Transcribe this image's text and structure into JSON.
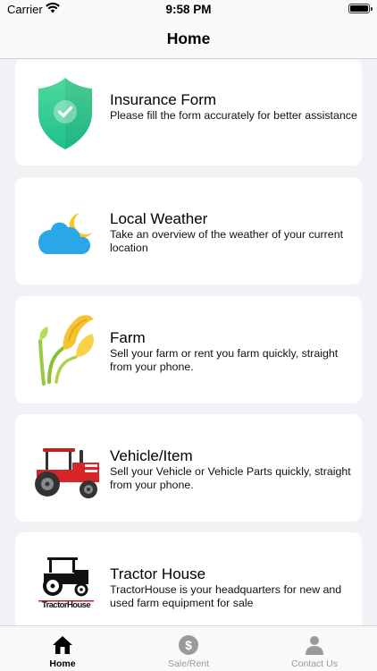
{
  "status_bar": {
    "carrier": "Carrier",
    "time": "9:58 PM",
    "battery_level": 1.0
  },
  "nav": {
    "title": "Home"
  },
  "cards": [
    {
      "title": "Insurance Form",
      "description": "Please fill the form accurately for better assistance",
      "icon": "shield-check-icon"
    },
    {
      "title": "Local Weather",
      "description": "Take an overview of the weather of your current location",
      "icon": "cloud-moon-icon"
    },
    {
      "title": "Farm",
      "description": "Sell your farm or rent you farm quickly, straight from your phone.",
      "icon": "wheat-icon"
    },
    {
      "title": "Vehicle/Item",
      "description": "Sell your Vehicle or Vehicle Parts quickly, straight from your phone.",
      "icon": "tractor-icon"
    },
    {
      "title": "Tractor House",
      "description": "TractorHouse is your headquarters for new and used farm equipment for sale",
      "icon": "tractorhouse-logo-icon",
      "logo_text": "TractorHouse"
    }
  ],
  "tabs": [
    {
      "label": "Home",
      "icon": "home-icon",
      "active": true
    },
    {
      "label": "Sale/Rent",
      "icon": "dollar-circle-icon",
      "active": false
    },
    {
      "label": "Contact Us",
      "icon": "person-icon",
      "active": false
    }
  ],
  "colors": {
    "active_tab": "#000000",
    "inactive_tab": "#9a9a9e",
    "shield": "#34c88a",
    "cloud": "#2aa7e6",
    "moon": "#f7c623",
    "tractor": "#d7262a"
  }
}
